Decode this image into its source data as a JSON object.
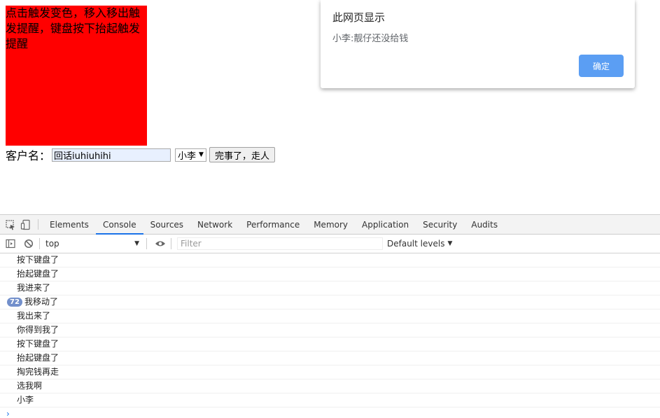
{
  "page": {
    "box_text": "点击触发变色，移入移出触发提醒，键盘按下抬起触发提醒",
    "customer_label": "客户名：",
    "input_value": "回话iuhiuhihi",
    "select_value": "小李",
    "submit_label": "完事了，走人"
  },
  "dialog": {
    "title": "此网页显示",
    "message": "小李:靓仔还没给钱",
    "ok_label": "确定"
  },
  "devtools": {
    "tabs": [
      "Elements",
      "Console",
      "Sources",
      "Network",
      "Performance",
      "Memory",
      "Application",
      "Security",
      "Audits"
    ],
    "active_tab": "Console",
    "context": "top",
    "filter_placeholder": "Filter",
    "levels_label": "Default levels",
    "logs": [
      {
        "text": "按下键盘了"
      },
      {
        "text": "抬起键盘了"
      },
      {
        "text": "我进来了"
      },
      {
        "text": "我移动了",
        "count": "72"
      },
      {
        "text": "我出来了"
      },
      {
        "text": "你得到我了"
      },
      {
        "text": "按下键盘了"
      },
      {
        "text": "抬起键盘了"
      },
      {
        "text": "掏完钱再走"
      },
      {
        "text": "选我啊"
      },
      {
        "text": "小李"
      }
    ],
    "prompt_symbol": "›"
  },
  "colors": {
    "box": "#ff0000",
    "ok_button": "#5b9ef3",
    "active_tab_underline": "#1a73e8",
    "badge": "#728fcb"
  }
}
